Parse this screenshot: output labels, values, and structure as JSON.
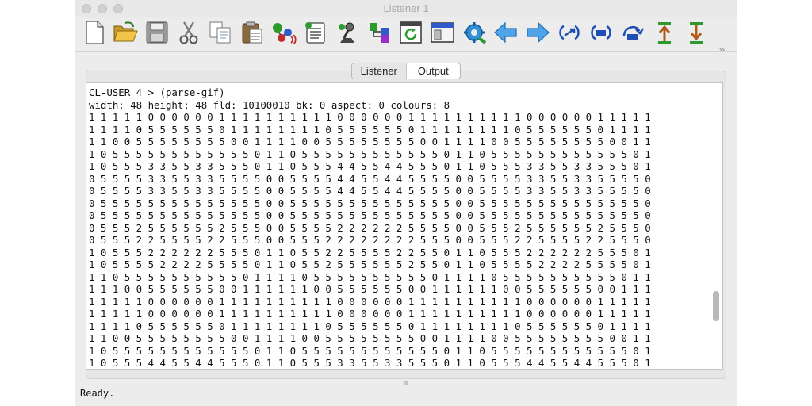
{
  "window": {
    "title": "Listener 1"
  },
  "toolbar": {
    "buttons": [
      "new-file-icon",
      "open-folder-icon",
      "save-icon",
      "cut-icon",
      "copy-icon",
      "paste-icon",
      "inspect-icon",
      "clipboard-list-icon",
      "tools-icon",
      "browser-icon",
      "refresh-icon",
      "window-icon",
      "settings-gear-icon",
      "back-arrow-icon",
      "forward-arrow-icon",
      "expand-icon",
      "shrink-icon",
      "rotate-icon",
      "upload-icon",
      "download-icon"
    ],
    "overflow": "»"
  },
  "tabs": [
    "Listener",
    "Output"
  ],
  "listener": {
    "lines": [
      "CL-USER 4 > (parse-gif)",
      "width: 48 height: 48 fld: 10100010 bk: 0 aspect: 0 colours: 8",
      "1 1 1 1 1 0 0 0 0 0 0 1 1 1 1 1 1 1 1 1 1 0 0 0 0 0 0 1 1 1 1 1 1 1 1 1 1 0 0 0 0 0 0 1 1 1 1 1",
      "1 1 1 1 0 5 5 5 5 5 5 0 1 1 1 1 1 1 1 1 0 5 5 5 5 5 5 0 1 1 1 1 1 1 1 1 0 5 5 5 5 5 5 0 1 1 1 1",
      "1 1 0 0 5 5 5 5 5 5 5 5 0 0 1 1 1 1 0 0 5 5 5 5 5 5 5 5 0 0 1 1 1 1 0 0 5 5 5 5 5 5 5 5 0 0 1 1",
      "1 0 5 5 5 5 5 5 5 5 5 5 5 5 0 1 1 0 5 5 5 5 5 5 5 5 5 5 5 5 0 1 1 0 5 5 5 5 5 5 5 5 5 5 5 5 0 1",
      "1 0 5 5 5 3 3 5 5 3 3 5 5 5 0 1 1 0 5 5 5 4 4 5 5 4 4 5 5 5 0 1 1 0 5 5 5 3 3 5 5 3 3 5 5 5 0 1",
      "0 5 5 5 5 3 3 5 5 3 3 5 5 5 5 0 0 5 5 5 5 4 4 5 5 4 4 5 5 5 5 0 0 5 5 5 5 3 3 5 5 3 3 5 5 5 5 0",
      "0 5 5 5 5 3 3 5 5 3 3 5 5 5 5 0 0 5 5 5 5 4 4 5 5 4 4 5 5 5 5 0 0 5 5 5 5 3 3 5 5 3 3 5 5 5 5 0",
      "0 5 5 5 5 5 5 5 5 5 5 5 5 5 5 0 0 5 5 5 5 5 5 5 5 5 5 5 5 5 5 0 0 5 5 5 5 5 5 5 5 5 5 5 5 5 5 0",
      "0 5 5 5 5 5 5 5 5 5 5 5 5 5 5 0 0 5 5 5 5 5 5 5 5 5 5 5 5 5 5 0 0 5 5 5 5 5 5 5 5 5 5 5 5 5 5 0",
      "0 5 5 5 2 5 5 5 5 5 5 2 5 5 5 0 0 5 5 5 5 2 2 2 2 2 2 5 5 5 5 0 0 5 5 5 2 5 5 5 5 5 5 2 5 5 5 0",
      "0 5 5 5 2 2 5 5 5 5 2 2 5 5 5 0 0 5 5 5 2 2 2 2 2 2 2 2 5 5 5 0 0 5 5 5 2 2 5 5 5 5 2 2 5 5 5 0",
      "1 0 5 5 5 2 2 2 2 2 2 5 5 5 0 1 1 0 5 5 2 2 5 5 5 5 2 2 5 5 0 1 1 0 5 5 5 2 2 2 2 2 2 5 5 5 0 1",
      "1 0 5 5 5 5 2 2 2 2 5 5 5 5 0 1 1 0 5 5 2 5 5 5 5 5 5 2 5 5 0 1 1 0 5 5 5 5 2 2 2 2 5 5 5 5 0 1",
      "1 1 0 5 5 5 5 5 5 5 5 5 5 0 1 1 1 1 0 5 5 5 5 5 5 5 5 5 5 0 1 1 1 1 0 5 5 5 5 5 5 5 5 5 5 0 1 1",
      "1 1 1 0 0 5 5 5 5 5 5 0 0 1 1 1 1 1 1 0 0 5 5 5 5 5 5 0 0 1 1 1 1 1 1 0 0 5 5 5 5 5 5 0 0 1 1 1",
      "1 1 1 1 1 0 0 0 0 0 0 1 1 1 1 1 1 1 1 1 1 0 0 0 0 0 0 1 1 1 1 1 1 1 1 1 1 0 0 0 0 0 0 1 1 1 1 1",
      "1 1 1 1 1 0 0 0 0 0 0 1 1 1 1 1 1 1 1 1 1 0 0 0 0 0 0 1 1 1 1 1 1 1 1 1 1 0 0 0 0 0 0 1 1 1 1 1",
      "1 1 1 1 0 5 5 5 5 5 5 0 1 1 1 1 1 1 1 1 0 5 5 5 5 5 5 0 1 1 1 1 1 1 1 1 0 5 5 5 5 5 5 0 1 1 1 1",
      "1 1 0 0 5 5 5 5 5 5 5 5 0 0 1 1 1 1 0 0 5 5 5 5 5 5 5 5 0 0 1 1 1 1 0 0 5 5 5 5 5 5 5 5 0 0 1 1",
      "1 0 5 5 5 5 5 5 5 5 5 5 5 5 0 1 1 0 5 5 5 5 5 5 5 5 5 5 5 5 0 1 1 0 5 5 5 5 5 5 5 5 5 5 5 5 0 1",
      "1 0 5 5 5 4 4 5 5 4 4 5 5 5 0 1 1 0 5 5 5 3 3 5 5 3 3 5 5 5 0 1 1 0 5 5 5 4 4 5 5 4 4 5 5 5 0 1"
    ]
  },
  "status": "Ready."
}
